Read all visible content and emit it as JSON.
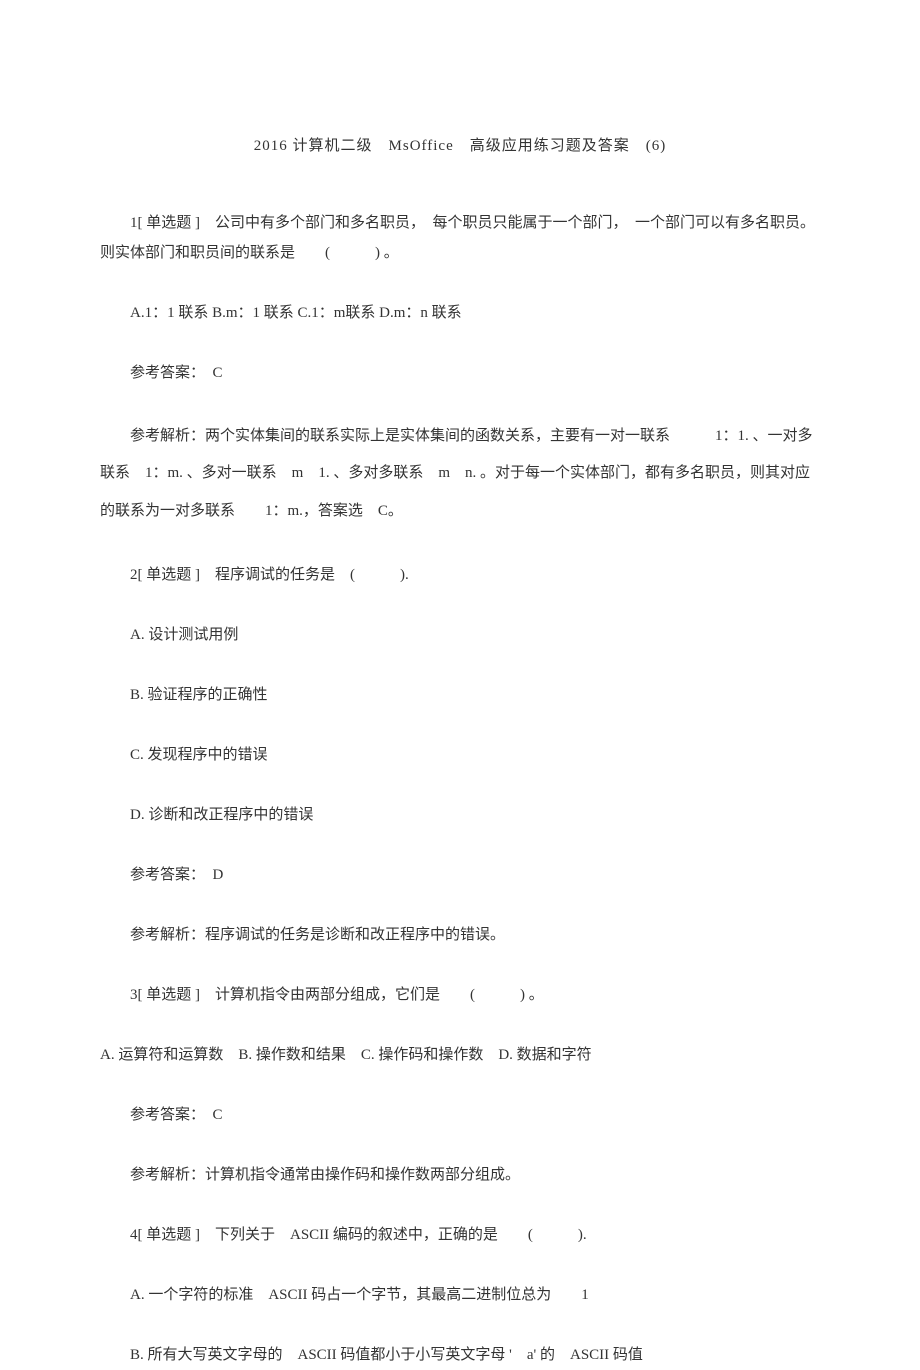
{
  "title": "2016 计算机二级　MsOffice　高级应用练习题及答案　(6)",
  "q1": {
    "stem": "1[ 单选题 ]　公司中有多个部门和多名职员，　每个职员只能属于一个部门，　一个部门可以有多名职员。则实体部门和职员间的联系是　　(　　　) 。",
    "options": "A.1：1 联系  B.m：1 联系  C.1：m联系  D.m：n 联系",
    "answer": "参考答案：　C",
    "analysis": "参考解析：两个实体集间的联系实际上是实体集间的函数关系，主要有一对一联系　　　1：1. 、一对多联系　1：m. 、多对一联系　m　1. 、多对多联系　m　n. 。对于每一个实体部门，都有多名职员，则其对应的联系为一对多联系　　1：m.，答案选　C。"
  },
  "q2": {
    "stem": "2[ 单选题 ]　程序调试的任务是　(　　　).",
    "optA": "A. 设计测试用例",
    "optB": "B. 验证程序的正确性",
    "optC": "C. 发现程序中的错误",
    "optD": "D. 诊断和改正程序中的错误",
    "answer": "参考答案：　D",
    "analysis": "参考解析：程序调试的任务是诊断和改正程序中的错误。"
  },
  "q3": {
    "stem": "3[ 单选题 ]　计算机指令由两部分组成，它们是　　(　　　) 。",
    "options": "A. 运算符和运算数　B. 操作数和结果　C. 操作码和操作数　D. 数据和字符",
    "answer": "参考答案：　C",
    "analysis": "参考解析：计算机指令通常由操作码和操作数两部分组成。"
  },
  "q4": {
    "stem": "4[ 单选题 ]　下列关于　ASCII 编码的叙述中，正确的是　　(　　　).",
    "optA": "A. 一个字符的标准　ASCII 码占一个字节，其最高二进制位总为　　1",
    "optB": "B. 所有大写英文字母的　ASCII 码值都小于小写英文字母 '　a' 的　ASCII 码值"
  }
}
